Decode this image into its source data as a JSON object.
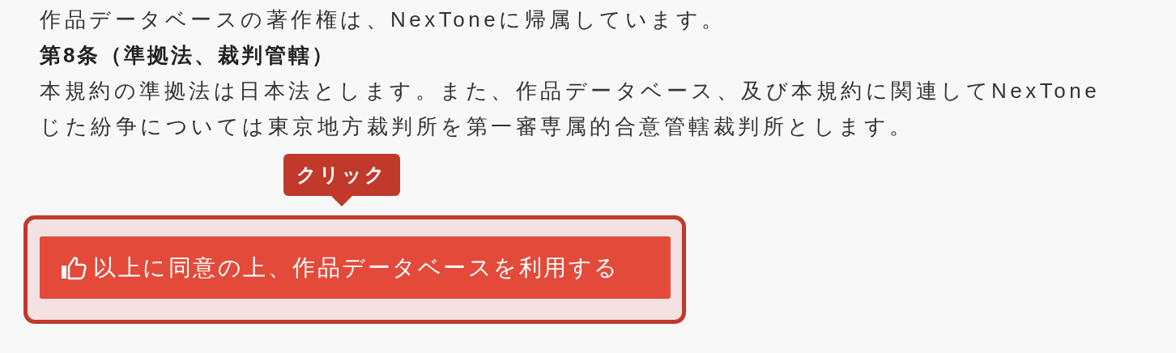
{
  "lines": [
    {
      "kind": "body",
      "text": "作品データベースの著作権は、NexToneに帰属しています。"
    },
    {
      "kind": "heading",
      "text": "第8条（準拠法、裁判管轄）"
    },
    {
      "kind": "body",
      "text": "本規約の準拠法は日本法とします。また、作品データベース、及び本規約に関連してNexTone"
    },
    {
      "kind": "body",
      "text": "じた紛争については東京地方裁判所を第一審専属的合意管轄裁判所とします。"
    }
  ],
  "tooltip": {
    "text": "クリック"
  },
  "agree_button": {
    "label": "以上に同意の上、作品データベースを利用する"
  }
}
